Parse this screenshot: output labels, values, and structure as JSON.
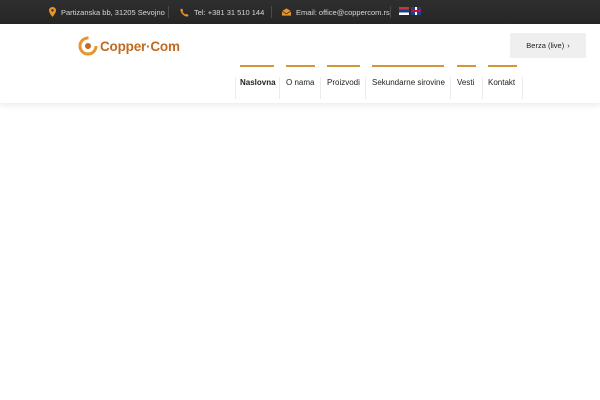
{
  "topbar": {
    "address": "Partizanska bb, 31205 Sevojno",
    "phone": "Tel: +381 31 510 144",
    "email": "Email: office@coppercom.rs",
    "languages": [
      "Serbian",
      "English"
    ]
  },
  "logo": {
    "text": "Copper·Com"
  },
  "header": {
    "berza_label": "Berza (live)"
  },
  "nav": {
    "items": [
      {
        "label": "Naslovna",
        "active": true
      },
      {
        "label": "O nama"
      },
      {
        "label": "Proizvodi"
      },
      {
        "label": "Sekundarne sirovine"
      },
      {
        "label": "Vesti"
      },
      {
        "label": "Kontakt"
      }
    ]
  },
  "colors": {
    "accent": "#d4963a",
    "topbar_bg": "#2a2a2a",
    "icon": "#e8952e",
    "logo": "#c26a1f"
  },
  "icons": [
    "map-pin-icon",
    "phone-icon",
    "envelope-icon",
    "chevron-right-icon"
  ]
}
